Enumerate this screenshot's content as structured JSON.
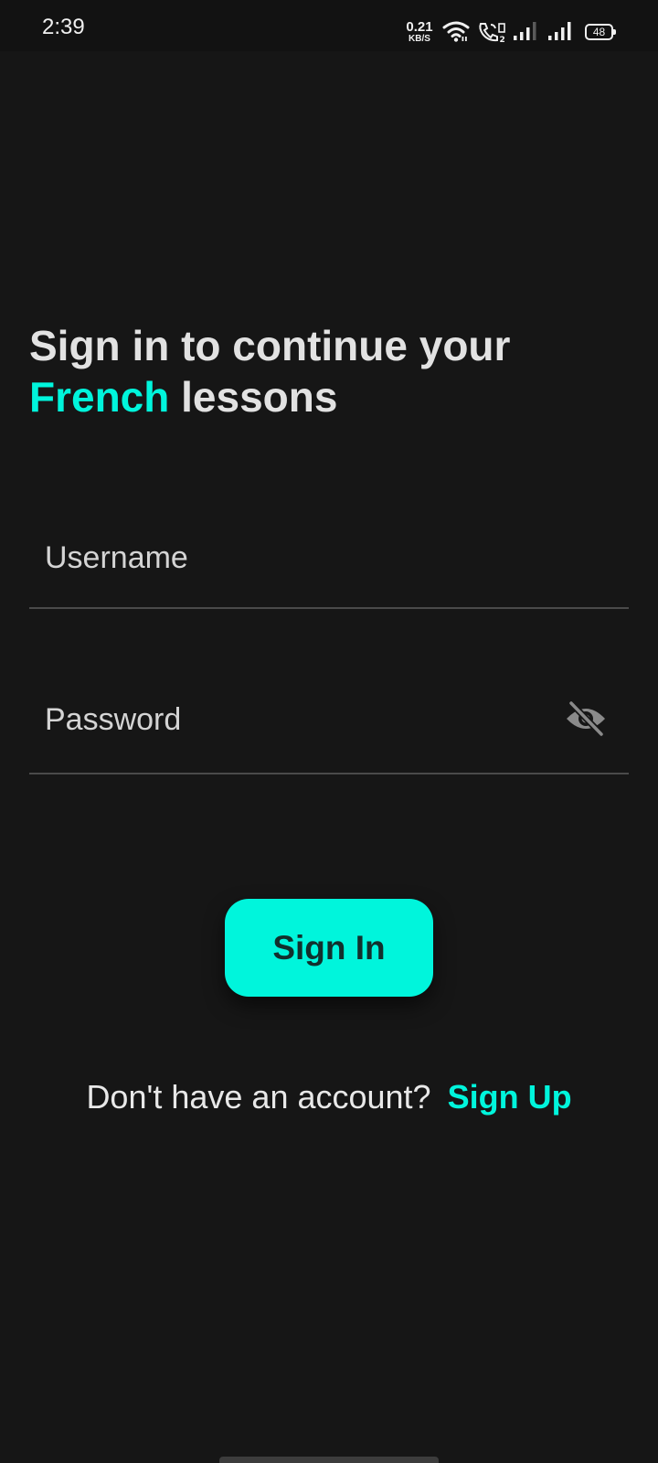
{
  "status_bar": {
    "time": "2:39",
    "net_speed_value": "0.21",
    "net_speed_unit": "KB/S",
    "battery_level": "48",
    "icons": [
      "wifi-icon",
      "volte-call-icon",
      "signal-icon",
      "signal-icon"
    ]
  },
  "heading": {
    "line1": "Sign in to continue your",
    "accent": "French",
    "rest": " lessons"
  },
  "form": {
    "username_placeholder": "Username",
    "password_placeholder": "Password",
    "password_toggle_icon": "eye-off-icon",
    "signin_label": "Sign In"
  },
  "footer": {
    "prompt": "Don't have an account?",
    "signup_label": "Sign Up"
  },
  "colors": {
    "background": "#161616",
    "accent": "#00f5dc",
    "button_text": "#12302d",
    "text": "#e2e2e2",
    "divider": "#4a4a4a"
  }
}
